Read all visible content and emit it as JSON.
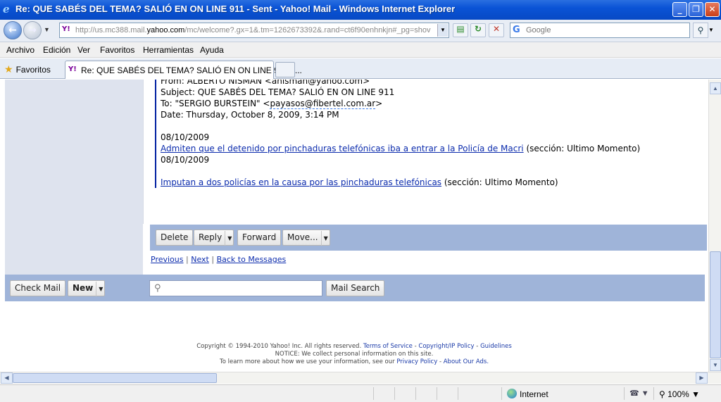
{
  "window": {
    "title": "Re: QUE SABÉS DEL TEMA? SALIÓ EN ON LINE 911 - Sent - Yahoo! Mail - Windows Internet Explorer",
    "minimize": "_",
    "restore": "❐",
    "close": "✕"
  },
  "address": {
    "url_prefix": "http://us.mc388.mail.",
    "url_domain": "yahoo.com",
    "url_suffix": "/mc/welcome?.gx=1&.tm=1262673392&.rand=ct6f90enhnkjn#_pg=shov",
    "search_placeholder": "Google"
  },
  "menu": [
    "Archivo",
    "Edición",
    "Ver",
    "Favoritos",
    "Herramientas",
    "Ayuda"
  ],
  "favorites_label": "Favoritos",
  "tab": {
    "label": "Re: QUE SABÉS DEL TEMA? SALIÓ EN ON LINE 911 - ..."
  },
  "message": {
    "from_line": "From: ALBERTO NISMAN <anisman@yahoo.com>",
    "subject_line": "Subject: QUE SABÉS DEL TEMA? SALIÓ EN ON LINE 911",
    "to_prefix": "To: \"SERGIO BURSTEIN\" <",
    "to_email": "payasos@fibertel.com.ar",
    "to_suffix": ">",
    "date_line": "Date: Thursday, October 8, 2009, 3:14 PM",
    "date1": "08/10/2009",
    "link1": "Admiten que el detenido por pinchaduras telefónicas iba a entrar a la Policía de Macri",
    "section1": " (sección: Ultimo Momento)",
    "date2": "08/10/2009",
    "link2": "Imputan a dos policías en la causa por las pinchaduras telefónicas",
    "section2": " (sección: Ultimo Momento)"
  },
  "actions": {
    "delete": "Delete",
    "reply": "Reply",
    "forward": "Forward",
    "move": "Move..."
  },
  "pager": {
    "previous": "Previous",
    "next": "Next",
    "back": "Back to Messages",
    "sep": "|"
  },
  "bottom": {
    "check_mail": "Check Mail",
    "new": "New",
    "mail_search": "Mail Search"
  },
  "footer": {
    "copyright": "Copyright © 1994-2010 Yahoo! Inc. All rights reserved.",
    "terms": "Terms of Service",
    "copyright_ip": "Copyright/IP Policy",
    "guidelines": "Guidelines",
    "notice": "NOTICE: We collect personal information on this site.",
    "learn": "To learn more about how we use your information, see our",
    "privacy": "Privacy Policy",
    "ads": "About Our Ads."
  },
  "status": {
    "zone": "Internet",
    "zoom": "100%"
  }
}
